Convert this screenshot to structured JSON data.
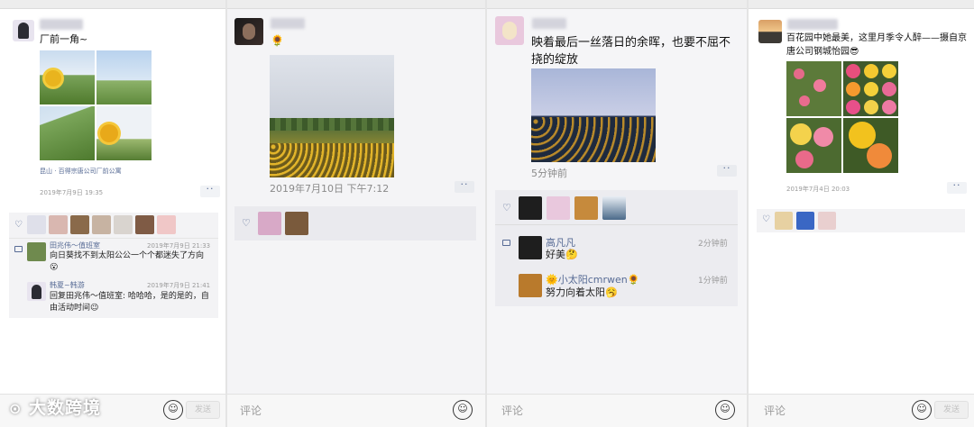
{
  "panels": [
    {
      "post_text": "厂前一角~",
      "location": "昆山 · 百得宗唐公司厂前公寓",
      "time": "2019年7月9日 19:35",
      "more": "··",
      "comments": [
        {
          "name": "田兆伟～值班室",
          "time": "2019年7月9日 21:33",
          "text": "向日葵找不到太阳公公一个个都迷失了方向😮"
        },
        {
          "name": "韩夏~韩游",
          "time": "2019年7月9日 21:41",
          "text": "回复田兆伟～值班室: 哈哈哈，是的是的，自由活动时间😉"
        }
      ],
      "input_placeholder": "",
      "send_label": "发送"
    },
    {
      "post_text": "🌻",
      "time": "2019年7月10日 下午7:12",
      "more": "··",
      "input_placeholder": "评论"
    },
    {
      "post_text": "映着最后一丝落日的余晖，也要不屈不挠的绽放",
      "time": "5分钟前",
      "more": "··",
      "comments": [
        {
          "name": "高凡凡",
          "time": "2分钟前",
          "text": "好美🤔"
        },
        {
          "name": "🌞小太阳cmrwen🌻",
          "time": "1分钟前",
          "text": "努力向着太阳🥱"
        }
      ],
      "input_placeholder": "评论"
    },
    {
      "post_text": "百花园中她最美，这里月季令人醉——摄自京唐公司钢城怡园😎",
      "time": "2019年7月4日 20:03",
      "more": "··",
      "input_placeholder": "评论",
      "send_label": "发送"
    }
  ],
  "watermark": "大数跨境",
  "icons": [
    "heart-icon",
    "comment-icon",
    "emoji-icon",
    "watermark-logo"
  ]
}
